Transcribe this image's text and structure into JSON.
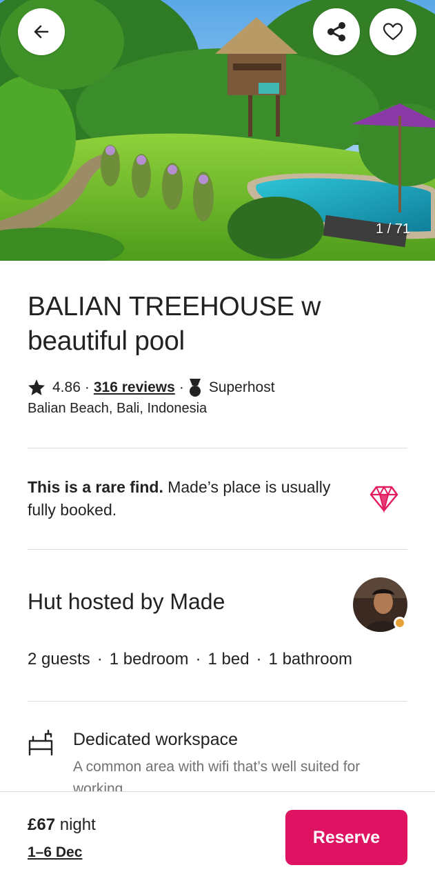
{
  "gallery": {
    "counter": "1 / 71"
  },
  "header": {
    "back_icon": "arrow-left-icon",
    "share_icon": "share-icon",
    "favorite_icon": "heart-icon"
  },
  "listing": {
    "title": "BALIAN TREEHOUSE w beautiful pool",
    "rating": "4.86",
    "reviews": "316 reviews",
    "superhost": "Superhost",
    "location": "Balian Beach, Bali, Indonesia"
  },
  "rare_find": {
    "bold": "This is a rare find.",
    "text": " Made’s place is usually fully booked.",
    "icon": "diamond-icon",
    "icon_color": "#e31c5f"
  },
  "host": {
    "heading": "Hut hosted by Made",
    "facts": [
      "2 guests",
      "1 bedroom",
      "1 bed",
      "1 bathroom"
    ]
  },
  "amenity": {
    "icon": "desk-icon",
    "title": "Dedicated workspace",
    "description": "A common area with wifi that’s well suited for working."
  },
  "booking": {
    "price": "£67",
    "price_unit": " night",
    "dates": "1–6 Dec",
    "reserve_label": "Reserve",
    "accent": "#de1462"
  }
}
